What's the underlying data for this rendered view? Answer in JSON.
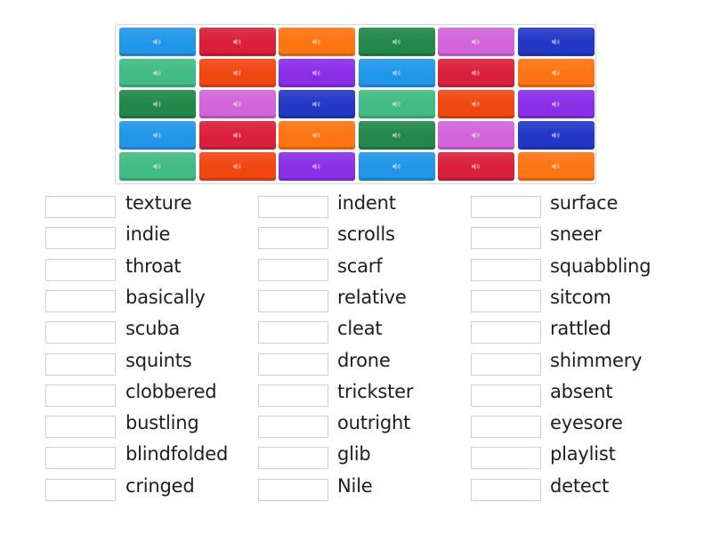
{
  "tile_grid": {
    "icon": "speaker-icon",
    "colors": {
      "blue": "#2196e9",
      "red": "#d91f3b",
      "orange": "#fd7412",
      "dark_green": "#22874a",
      "pink": "#d264da",
      "dark_blue": "#2337c6",
      "green": "#41bb83",
      "red_orange": "#f04612",
      "purple": "#8a2ee8"
    },
    "rows": [
      [
        "blue",
        "red",
        "orange",
        "dark_green",
        "pink",
        "dark_blue"
      ],
      [
        "green",
        "red_orange",
        "purple",
        "blue",
        "red",
        "orange"
      ],
      [
        "dark_green",
        "pink",
        "dark_blue",
        "green",
        "red_orange",
        "purple"
      ],
      [
        "blue",
        "red",
        "orange",
        "dark_green",
        "pink",
        "dark_blue"
      ],
      [
        "green",
        "red_orange",
        "purple",
        "blue",
        "red",
        "orange"
      ]
    ]
  },
  "word_columns": [
    {
      "words": [
        "texture",
        "indie",
        "throat",
        "basically",
        "scuba",
        "squints",
        "clobbered",
        "bustling",
        "blindfolded",
        "cringed"
      ]
    },
    {
      "words": [
        "indent",
        "scrolls",
        "scarf",
        "relative",
        "cleat",
        "drone",
        "trickster",
        "outright",
        "glib",
        "Nile"
      ]
    },
    {
      "words": [
        "surface",
        "sneer",
        "squabbling",
        "sitcom",
        "rattled",
        "shimmery",
        "absent",
        "eyesore",
        "playlist",
        "detect"
      ]
    }
  ],
  "answer_box_values": [
    [
      "",
      "",
      "",
      "",
      "",
      "",
      "",
      "",
      "",
      ""
    ],
    [
      "",
      "",
      "",
      "",
      "",
      "",
      "",
      "",
      "",
      ""
    ],
    [
      "",
      "",
      "",
      "",
      "",
      "",
      "",
      "",
      "",
      ""
    ]
  ]
}
